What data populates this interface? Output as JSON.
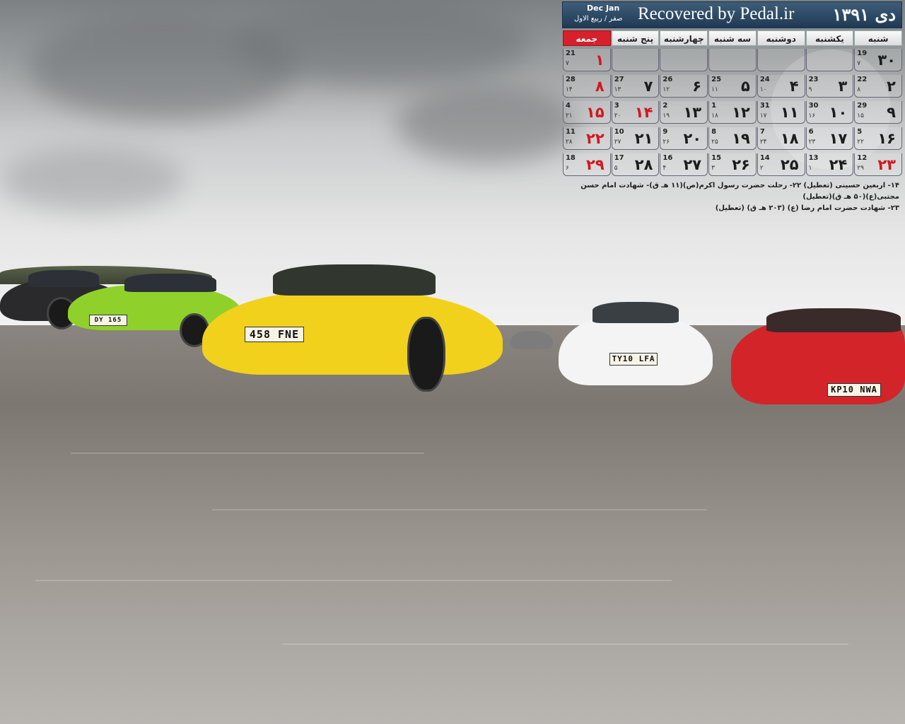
{
  "calendar": {
    "month_year": "دی ۱۳۹۱",
    "title": "Recovered by Pedal.ir",
    "gregorian_months": "Dec Jan",
    "hijri_months": "صفر / ربیع الاول",
    "day_names": [
      "شنبه",
      "یکشنبه",
      "دوشنبه",
      "سه شنبه",
      "چهارشنبه",
      "پنج شنبه",
      "جمعه"
    ],
    "weeks": [
      [
        {
          "p": "۳۰",
          "g": "19",
          "h": "۷"
        },
        {
          "p": "",
          "g": "",
          "h": ""
        },
        {
          "p": "",
          "g": "",
          "h": ""
        },
        {
          "p": "",
          "g": "",
          "h": ""
        },
        {
          "p": "",
          "g": "",
          "h": ""
        },
        {
          "p": "",
          "g": "",
          "h": ""
        },
        {
          "p": "۱",
          "g": "21",
          "h": "۷",
          "hol": true
        }
      ],
      [
        {
          "p": "۲",
          "g": "22",
          "h": "۸"
        },
        {
          "p": "۳",
          "g": "23",
          "h": "۹"
        },
        {
          "p": "۴",
          "g": "24",
          "h": "۱۰"
        },
        {
          "p": "۵",
          "g": "25",
          "h": "۱۱"
        },
        {
          "p": "۶",
          "g": "26",
          "h": "۱۲"
        },
        {
          "p": "۷",
          "g": "27",
          "h": "۱۳"
        },
        {
          "p": "۸",
          "g": "28",
          "h": "۱۴",
          "hol": true
        }
      ],
      [
        {
          "p": "۹",
          "g": "29",
          "h": "۱۵"
        },
        {
          "p": "۱۰",
          "g": "30",
          "h": "۱۶"
        },
        {
          "p": "۱۱",
          "g": "31",
          "h": "۱۷"
        },
        {
          "p": "۱۲",
          "g": "1",
          "h": "۱۸"
        },
        {
          "p": "۱۳",
          "g": "2",
          "h": "۱۹"
        },
        {
          "p": "۱۴",
          "g": "3",
          "h": "۲۰",
          "hol": true
        },
        {
          "p": "۱۵",
          "g": "4",
          "h": "۲۱",
          "hol": true
        }
      ],
      [
        {
          "p": "۱۶",
          "g": "5",
          "h": "۲۲"
        },
        {
          "p": "۱۷",
          "g": "6",
          "h": "۲۳"
        },
        {
          "p": "۱۸",
          "g": "7",
          "h": "۲۴"
        },
        {
          "p": "۱۹",
          "g": "8",
          "h": "۲۵"
        },
        {
          "p": "۲۰",
          "g": "9",
          "h": "۲۶"
        },
        {
          "p": "۲۱",
          "g": "10",
          "h": "۲۷"
        },
        {
          "p": "۲۲",
          "g": "11",
          "h": "۲۸",
          "hol": true
        }
      ],
      [
        {
          "p": "۲۳",
          "g": "12",
          "h": "۲۹",
          "hol": true
        },
        {
          "p": "۲۴",
          "g": "13",
          "h": "۱"
        },
        {
          "p": "۲۵",
          "g": "14",
          "h": "۲"
        },
        {
          "p": "۲۶",
          "g": "15",
          "h": "۳"
        },
        {
          "p": "۲۷",
          "g": "16",
          "h": "۴"
        },
        {
          "p": "۲۸",
          "g": "17",
          "h": "۵"
        },
        {
          "p": "۲۹",
          "g": "18",
          "h": "۶",
          "hol": true
        }
      ]
    ],
    "notes": [
      "۱۴- اربعین حسینی (تعطیل) ۲۲- رحلت حضرت رسول اکرم(ص)(۱۱ هـ ق)- شهادت امام حسن مجتبی(ع)(۵۰ هـ ق)(تعطیل)",
      "۲۳- شهادت حضرت امام رضا (ع) (۲۰۳ هـ ق) (تعطیل)"
    ]
  },
  "cars": {
    "plate_green": "DY 165",
    "plate_yellow": "458 FNE",
    "plate_white": "TY10 LFA",
    "plate_red": "KP10 NWA"
  },
  "colors": {
    "header_blue": "#1f3a55",
    "holiday_red": "#d11820",
    "yellow_car": "#f2d11c",
    "green_car": "#8fd12a",
    "white_car": "#f4f4f4",
    "red_car": "#d3242a",
    "black_car": "#2a2a2c"
  }
}
